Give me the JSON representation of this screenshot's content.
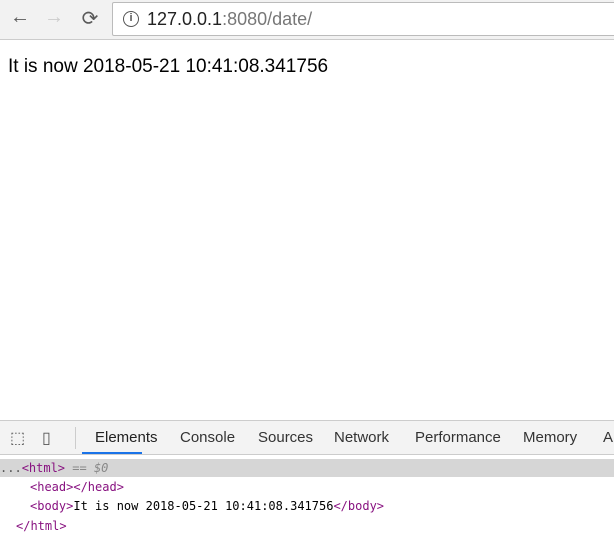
{
  "browser": {
    "url_host": "127.0.0.1",
    "url_rest": ":8080/date/",
    "back": "←",
    "forward": "→",
    "reload": "⟳",
    "info": "i"
  },
  "page": {
    "text": "It is now 2018-05-21 10:41:08.341756"
  },
  "devtools": {
    "tabs": [
      "Elements",
      "Console",
      "Sources",
      "Network",
      "Performance",
      "Memory",
      "A"
    ],
    "active_tab": "Elements",
    "selected": {
      "ellipsis": "...",
      "tag": "<html>",
      "suffix": "== $0"
    },
    "lines": {
      "head": "<head></head>",
      "body_open": "<body>",
      "body_text": "It is now 2018-05-21 10:41:08.341756",
      "body_close": "</body>",
      "html_close": "</html>"
    }
  }
}
